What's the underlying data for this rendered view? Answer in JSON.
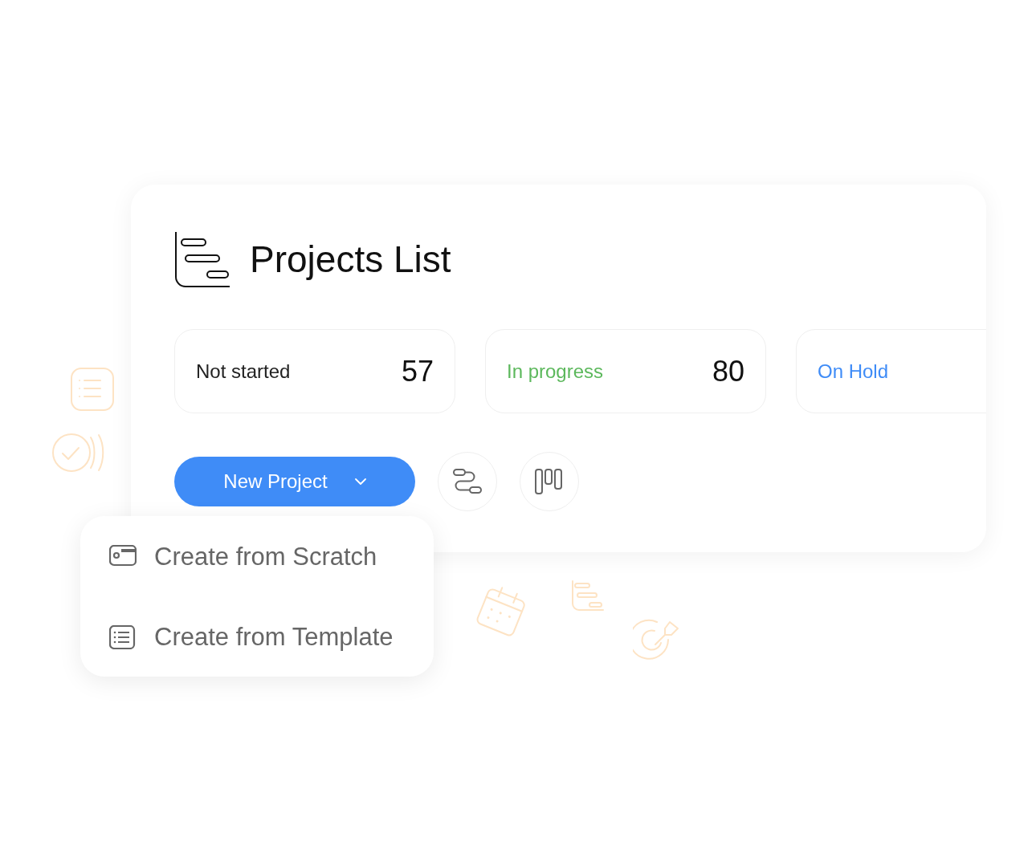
{
  "header": {
    "title": "Projects List"
  },
  "status_cards": [
    {
      "label": "Not started",
      "count": "57",
      "color": "#222222"
    },
    {
      "label": "In progress",
      "count": "80",
      "color": "#5cb85c"
    },
    {
      "label": "On Hold",
      "color": "#3f8cf7"
    }
  ],
  "new_project_button": {
    "label": "New Project",
    "expanded": true
  },
  "view_buttons": [
    {
      "kind": "flow"
    },
    {
      "kind": "board"
    }
  ],
  "menu": {
    "items": [
      {
        "label": "Create from Scratch",
        "kind": "scratch"
      },
      {
        "label": "Create from Template",
        "kind": "template"
      }
    ]
  }
}
